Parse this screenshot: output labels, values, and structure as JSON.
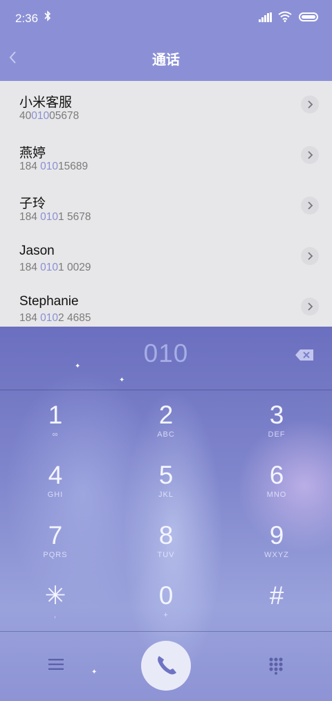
{
  "status_bar": {
    "time": "2:36",
    "bluetooth_icon": "bluetooth-icon",
    "signal_icon": "signal-icon",
    "wifi_icon": "wifi-icon",
    "battery_icon": "battery-icon"
  },
  "header": {
    "title": "通话",
    "back_icon": "back-chevron-icon"
  },
  "contacts": [
    {
      "name": "小米客服",
      "num_pre": "40",
      "num_hl": "010",
      "num_post": "05678"
    },
    {
      "name": "燕婷",
      "num_pre": "184 ",
      "num_hl": "010",
      "num_post": "15689"
    },
    {
      "name": "子玲",
      "num_pre": "184 ",
      "num_hl": "010",
      "num_post": "1 5678"
    },
    {
      "name": "Jason",
      "num_pre": "184 ",
      "num_hl": "010",
      "num_post": "1 0029"
    },
    {
      "name": "Stephanie",
      "num_pre": "184 ",
      "num_hl": "010",
      "num_post": "2 4685"
    }
  ],
  "dialer": {
    "entered": "010",
    "keys": [
      {
        "num": "1",
        "sub": "∞"
      },
      {
        "num": "2",
        "sub": "ABC"
      },
      {
        "num": "3",
        "sub": "DEF"
      },
      {
        "num": "4",
        "sub": "GHI"
      },
      {
        "num": "5",
        "sub": "JKL"
      },
      {
        "num": "6",
        "sub": "MNO"
      },
      {
        "num": "7",
        "sub": "PQRS"
      },
      {
        "num": "8",
        "sub": "TUV"
      },
      {
        "num": "9",
        "sub": "WXYZ"
      },
      {
        "num": "✳",
        "sub": ","
      },
      {
        "num": "0",
        "sub": "+"
      },
      {
        "num": "#",
        "sub": ""
      }
    ]
  },
  "colors": {
    "header_bg": "#8b90d6",
    "highlight": "#8a8fd2",
    "list_bg": "#e7e7e9"
  }
}
